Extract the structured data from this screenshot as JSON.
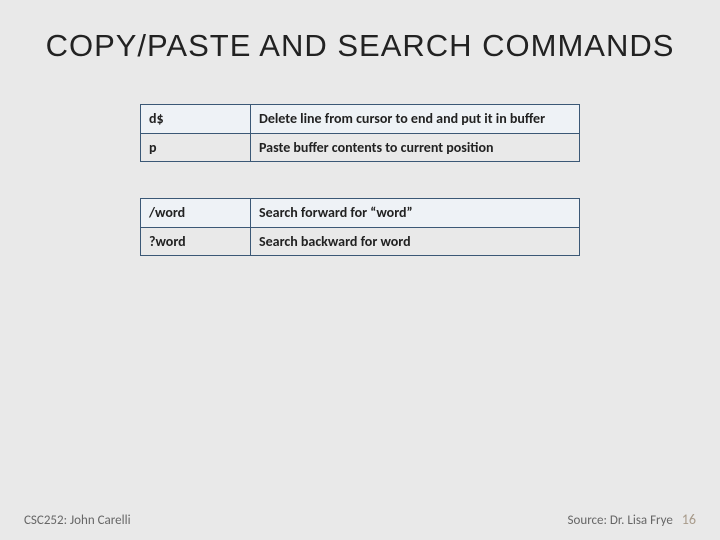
{
  "title": "COPY/PASTE AND SEARCH COMMANDS",
  "table1": {
    "rows": [
      {
        "cmd": "d$",
        "desc": "Delete line from cursor to end and put it in buffer"
      },
      {
        "cmd": "p",
        "desc": "Paste buffer contents to current position"
      }
    ]
  },
  "table2": {
    "rows": [
      {
        "cmd": "/word",
        "desc": "Search forward for “word”"
      },
      {
        "cmd": "?word",
        "desc": "Search backward for word"
      }
    ]
  },
  "footer": {
    "left": "CSC252: John Carelli",
    "right": "Source: Dr. Lisa Frye",
    "page": "16"
  }
}
